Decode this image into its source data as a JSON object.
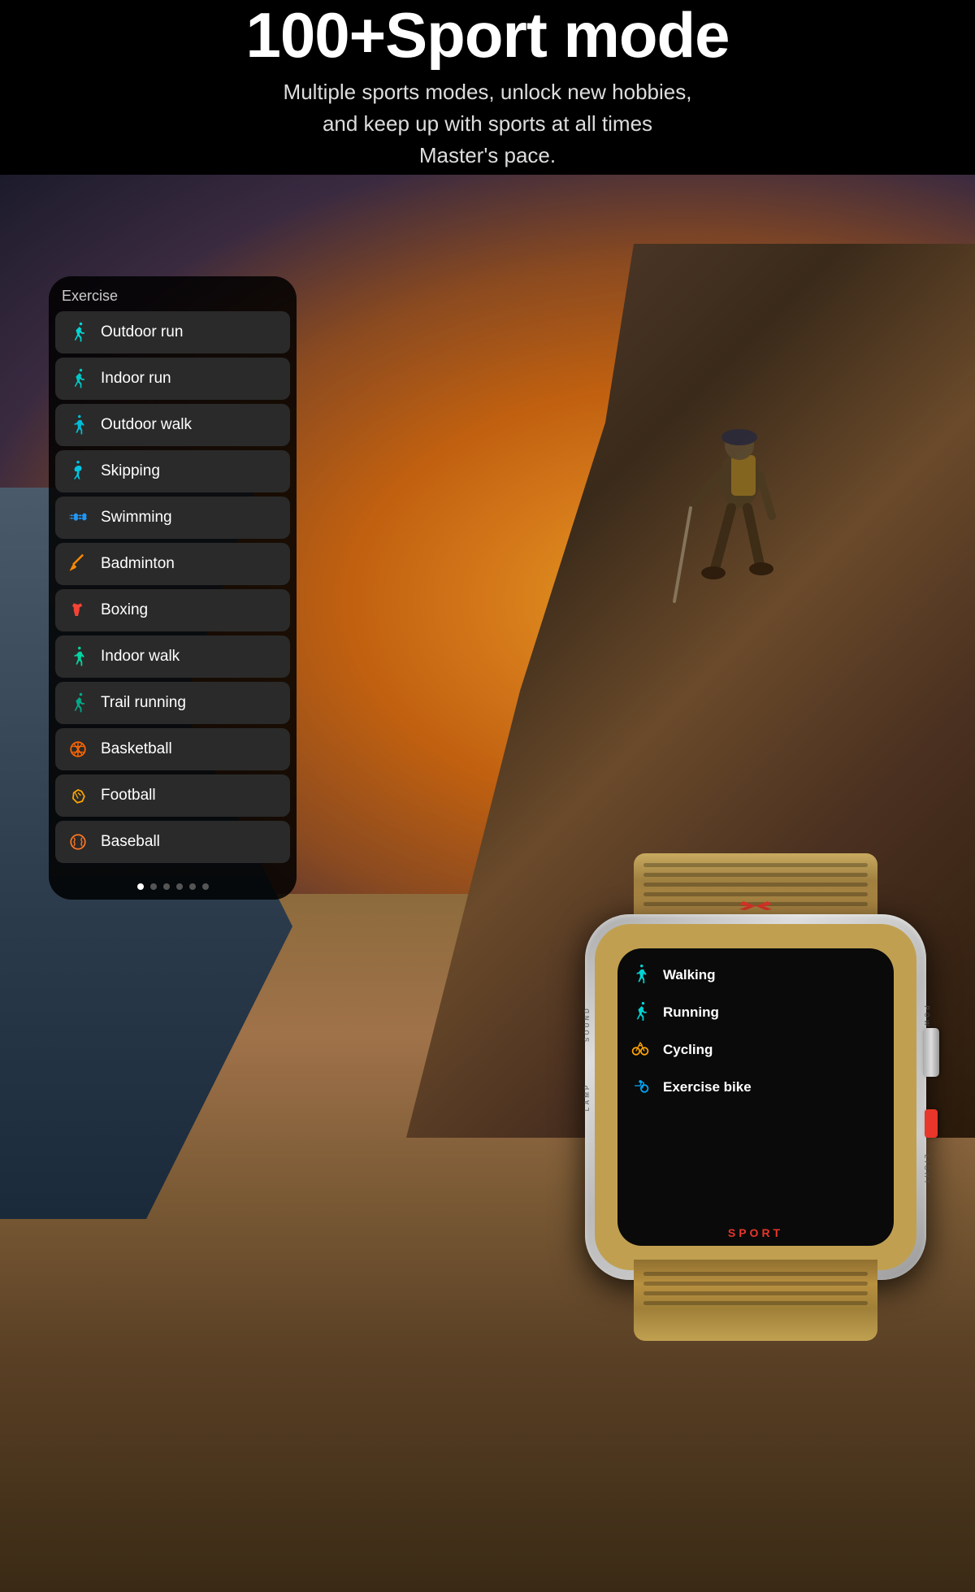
{
  "header": {
    "title": "100+Sport mode",
    "subtitle_line1": "Multiple sports modes, unlock new hobbies,",
    "subtitle_line2": "and keep up with sports at all times",
    "subtitle_line3": "Master's pace."
  },
  "exercise_label": "Exercise",
  "sports_list": [
    {
      "name": "Outdoor run",
      "icon": "🏃",
      "color": "cyan"
    },
    {
      "name": "Indoor run",
      "icon": "🏃",
      "color": "cyan"
    },
    {
      "name": "Outdoor walk",
      "icon": "🚶",
      "color": "teal"
    },
    {
      "name": "Skipping",
      "icon": "⚡",
      "color": "teal"
    },
    {
      "name": "Swimming",
      "icon": "🌊",
      "color": "blue"
    },
    {
      "name": "Badminton",
      "icon": "🏸",
      "color": "orange"
    },
    {
      "name": "Boxing",
      "icon": "🥊",
      "color": "red"
    },
    {
      "name": "Indoor walk",
      "icon": "🚶",
      "color": "cyan"
    },
    {
      "name": "Trail running",
      "icon": "🏔️",
      "color": "teal"
    },
    {
      "name": "Basketball",
      "icon": "🏀",
      "color": "orange"
    },
    {
      "name": "Football",
      "icon": "⚽",
      "color": "amber"
    },
    {
      "name": "Baseball",
      "icon": "⚾",
      "color": "orange"
    }
  ],
  "watch_sports": [
    {
      "name": "Walking",
      "icon": "🚶",
      "color": "#00d4d4"
    },
    {
      "name": "Running",
      "icon": "🏃",
      "color": "#00d4d4"
    },
    {
      "name": "Cycling",
      "icon": "🚴",
      "color": "#ffa500"
    },
    {
      "name": "Exercise bike",
      "icon": "🚵",
      "color": "#00aaff"
    }
  ],
  "watch_labels": {
    "lamp": "LAMP",
    "power": "POWER",
    "sound": "SOUND",
    "light": "LIGHT",
    "sport": "SPORT"
  },
  "dots": [
    true,
    false,
    false,
    false,
    false,
    false
  ]
}
